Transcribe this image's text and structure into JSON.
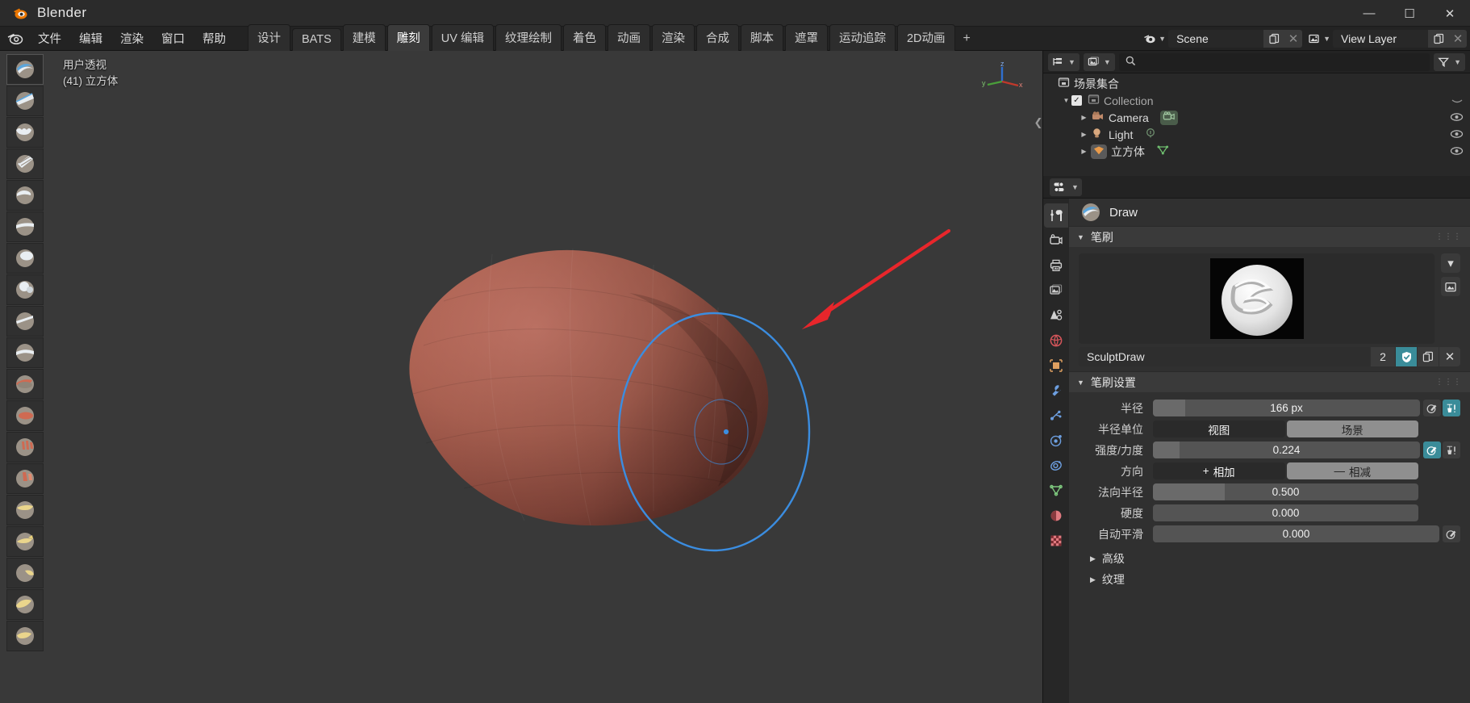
{
  "titlebar": {
    "app_title": "Blender",
    "logo_icon": "blender-logo-icon",
    "minimize_label": "—",
    "maximize_label": "☐",
    "close_label": "✕"
  },
  "topbar": {
    "logo_icon": "blender-menu-icon",
    "menus": [
      {
        "label": "文件",
        "name": "menu-file"
      },
      {
        "label": "编辑",
        "name": "menu-edit"
      },
      {
        "label": "渲染",
        "name": "menu-render"
      },
      {
        "label": "窗口",
        "name": "menu-window"
      },
      {
        "label": "帮助",
        "name": "menu-help"
      }
    ],
    "workspaces": [
      {
        "label": "设计",
        "active": false
      },
      {
        "label": "BATS",
        "active": false
      },
      {
        "label": "建模",
        "active": false
      },
      {
        "label": "雕刻",
        "active": true
      },
      {
        "label": "UV 编辑",
        "active": false
      },
      {
        "label": "纹理绘制",
        "active": false
      },
      {
        "label": "着色",
        "active": false
      },
      {
        "label": "动画",
        "active": false
      },
      {
        "label": "渲染",
        "active": false
      },
      {
        "label": "合成",
        "active": false
      },
      {
        "label": "脚本",
        "active": false
      },
      {
        "label": "遮罩",
        "active": false
      },
      {
        "label": "运动追踪",
        "active": false
      },
      {
        "label": "2D动画",
        "active": false
      }
    ],
    "add_workspace_label": "+",
    "scene": {
      "browse_icon": "scene-browse-icon",
      "name": "Scene",
      "new_icon": "new-scene-icon",
      "delete_icon": "x-icon"
    },
    "view_layer": {
      "browse_icon": "viewlayer-browse-icon",
      "name": "View Layer",
      "new_icon": "new-viewlayer-icon",
      "delete_icon": "x-icon"
    }
  },
  "viewport": {
    "perspective_label": "用户透视",
    "object_label": "(41) 立方体",
    "gizmo_axes": {
      "z": "z",
      "y": "y",
      "x": "x"
    },
    "sidebar_toggle_icon": "chevron-left-icon",
    "tools": [
      {
        "name": "tool-draw",
        "label": "绘制",
        "active": true
      },
      {
        "name": "tool-draw-sharp",
        "label": "锐利绘制",
        "active": false
      },
      {
        "name": "tool-clay",
        "label": "粘土",
        "active": false
      },
      {
        "name": "tool-clay-strips",
        "label": "粘土条带",
        "active": false
      },
      {
        "name": "tool-clay-thumb",
        "label": "粘土指滑",
        "active": false
      },
      {
        "name": "tool-layer",
        "label": "层",
        "active": false
      },
      {
        "name": "tool-inflate",
        "label": "膨胀",
        "active": false
      },
      {
        "name": "tool-blob",
        "label": "气泡",
        "active": false
      },
      {
        "name": "tool-crease",
        "label": "折痕",
        "active": false
      },
      {
        "name": "tool-smooth",
        "label": "平滑",
        "active": false
      },
      {
        "name": "tool-flatten",
        "label": "压平",
        "active": false
      },
      {
        "name": "tool-fill",
        "label": "填充",
        "active": false
      },
      {
        "name": "tool-scrape",
        "label": "刮削",
        "active": false
      },
      {
        "name": "tool-multiplane-scrape",
        "label": "多平面刮削",
        "active": false
      },
      {
        "name": "tool-pinch",
        "label": "捂挺",
        "active": false
      },
      {
        "name": "tool-grab",
        "label": "抓取",
        "active": false
      },
      {
        "name": "tool-elastic-deform",
        "label": "弹性变形",
        "active": false
      },
      {
        "name": "tool-snake-hook",
        "label": "蛇形钩",
        "active": false
      },
      {
        "name": "tool-thumb",
        "label": "指滑",
        "active": false
      }
    ],
    "brush_cursor": {
      "radius_px": 166,
      "color": "#3b8de0"
    },
    "annotation_arrow": {
      "color": "#e8262b"
    }
  },
  "outliner": {
    "display_mode_icon": "outliner-display-icon",
    "filter_collection_icon": "outliner-id-icon",
    "search_icon": "search-icon",
    "search_value": "",
    "search_placeholder": "",
    "filter_icon": "filter-funnel-icon",
    "rows": [
      {
        "name": "outliner-row-scene-collection",
        "label": "场景集合",
        "indent": 0,
        "icon": "collection-icon",
        "disclosure": "",
        "checkbox": false,
        "right_icons": [],
        "dim": false
      },
      {
        "name": "outliner-row-collection",
        "label": "Collection",
        "indent": 1,
        "icon": "collection-icon",
        "disclosure": "▼",
        "checkbox": true,
        "right_icons": [
          "hidden-eye-icon"
        ],
        "dim": true
      },
      {
        "name": "outliner-row-camera",
        "label": "Camera",
        "indent": 2,
        "icon": "camera-object-icon",
        "disclosure": "▶",
        "checkbox": false,
        "right_icons": [
          "eye-icon"
        ],
        "badge": "camera-data-icon",
        "dim": false
      },
      {
        "name": "outliner-row-light",
        "label": "Light",
        "indent": 2,
        "icon": "light-object-icon",
        "disclosure": "▶",
        "checkbox": false,
        "right_icons": [
          "eye-icon"
        ],
        "badge": "light-data-icon",
        "dim": false
      },
      {
        "name": "outliner-row-cube",
        "label": "立方体",
        "indent": 2,
        "icon": "mesh-object-icon",
        "disclosure": "▶",
        "checkbox": false,
        "right_icons": [
          "eye-icon"
        ],
        "badge": "mesh-data-icon",
        "dim": false
      }
    ]
  },
  "properties": {
    "editor_type_icon": "properties-editor-icon",
    "tabs": [
      {
        "name": "ptab-tool",
        "icon": "tool-wrench-icon",
        "active": true,
        "color": "#d8d8d8"
      },
      {
        "name": "ptab-render",
        "icon": "render-camera-icon",
        "active": false,
        "color": "#d0d0d0"
      },
      {
        "name": "ptab-output",
        "icon": "output-printer-icon",
        "active": false,
        "color": "#d0d0d0"
      },
      {
        "name": "ptab-viewlayer",
        "icon": "viewlayer-images-icon",
        "active": false,
        "color": "#d0d0d0"
      },
      {
        "name": "ptab-scene",
        "icon": "scene-cone-icon",
        "active": false,
        "color": "#d0d0d0"
      },
      {
        "name": "ptab-world",
        "icon": "world-globe-icon",
        "active": false,
        "color": "#d4555a"
      },
      {
        "name": "ptab-object",
        "icon": "object-square-icon",
        "active": false,
        "color": "#e0a060"
      },
      {
        "name": "ptab-modifiers",
        "icon": "wrench-icon",
        "active": false,
        "color": "#6d9fe0"
      },
      {
        "name": "ptab-particles",
        "icon": "particles-icon",
        "active": false,
        "color": "#6d9fe0"
      },
      {
        "name": "ptab-physics",
        "icon": "physics-orbit-icon",
        "active": false,
        "color": "#6d9fe0"
      },
      {
        "name": "ptab-constraints",
        "icon": "constraints-icon",
        "active": false,
        "color": "#6d9fe0"
      },
      {
        "name": "ptab-data",
        "icon": "mesh-data-green-icon",
        "active": false,
        "color": "#7ec87e"
      },
      {
        "name": "ptab-material",
        "icon": "material-sphere-icon",
        "active": false,
        "color": "#e07a80"
      },
      {
        "name": "ptab-texture",
        "icon": "texture-checker-icon",
        "active": false,
        "color": "#e07a80"
      }
    ],
    "brush_header": {
      "icon": "draw-brush-icon",
      "title": "Draw"
    },
    "panel_brush": {
      "title": "笔刷",
      "expanded": true,
      "preview_icon": "brush-preview-sculptdraw",
      "side_buttons": [
        {
          "name": "brush-preset-dropdown",
          "icon": "chevron-down-icon"
        },
        {
          "name": "brush-preview-type",
          "icon": "image-icon"
        }
      ],
      "datablock": {
        "name": "SculptDraw",
        "users": "2",
        "fake_user_icon": "shield-check-icon",
        "new_icon": "copy-icon",
        "unlink_icon": "x-icon"
      }
    },
    "panel_brush_settings": {
      "title": "笔刷设置",
      "expanded": true,
      "rows": [
        {
          "name": "row-radius",
          "label": "半径",
          "value": "166 px",
          "type": "slider",
          "fill_pct": 12,
          "buttons": [
            {
              "name": "radius-pressure-toggle",
              "icon": "pressure-icon",
              "on": false
            },
            {
              "name": "radius-unified-toggle",
              "icon": "unified-icon",
              "on": true
            }
          ]
        },
        {
          "name": "row-radius-unit",
          "label": "半径单位",
          "type": "segmented",
          "options": [
            {
              "label": "视图",
              "selected": true
            },
            {
              "label": "场景",
              "selected": false
            }
          ]
        },
        {
          "name": "row-strength",
          "label": "强度/力度",
          "value": "0.224",
          "type": "slider",
          "fill_pct": 10,
          "buttons": [
            {
              "name": "strength-pressure-toggle",
              "icon": "pressure-icon",
              "on": true
            },
            {
              "name": "strength-unified-toggle",
              "icon": "unified-icon",
              "on": false
            }
          ]
        },
        {
          "name": "row-direction",
          "label": "方向",
          "type": "segmented",
          "options": [
            {
              "label": "相加",
              "prefix": "+",
              "selected": true
            },
            {
              "label": "相减",
              "prefix": "—",
              "selected": false
            }
          ]
        },
        {
          "name": "row-normal-radius",
          "label": "法向半径",
          "value": "0.500",
          "type": "slider",
          "fill_pct": 27,
          "buttons": []
        },
        {
          "name": "row-hardness",
          "label": "硬度",
          "value": "0.000",
          "type": "slider",
          "fill_pct": 0,
          "buttons": []
        },
        {
          "name": "row-autosmooth",
          "label": "自动平滑",
          "value": "0.000",
          "type": "slider",
          "fill_pct": 0,
          "buttons": [
            {
              "name": "autosmooth-pressure-toggle",
              "icon": "pressure-icon",
              "on": false
            }
          ]
        }
      ],
      "subpanels": [
        {
          "name": "subpanel-advanced",
          "label": "高级",
          "expanded": false
        },
        {
          "name": "subpanel-texture",
          "label": "纹理",
          "expanded": false
        }
      ]
    }
  }
}
